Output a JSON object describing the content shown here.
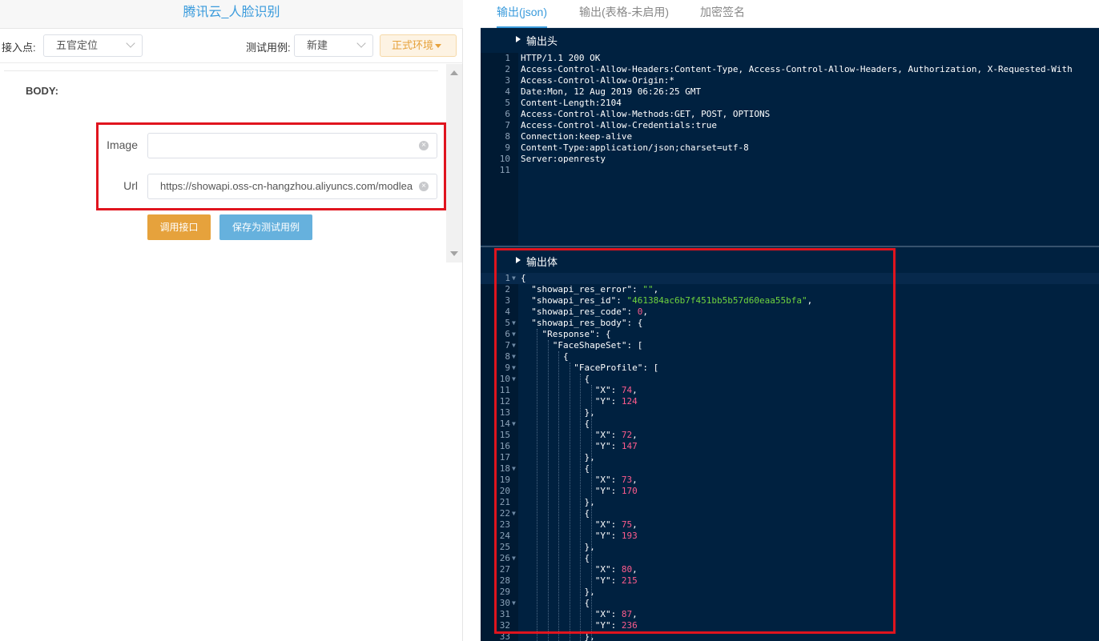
{
  "left": {
    "title": "腾讯云_人脸识别",
    "toolbar": {
      "endpoint_label": "接入点:",
      "endpoint_value": "五官定位",
      "testcase_label": "测试用例:",
      "testcase_value": "新建",
      "env_button": "正式环境"
    },
    "body_label": "BODY:",
    "fields": [
      {
        "label": "Image",
        "value": ""
      },
      {
        "label": "Url",
        "value": "https://showapi.oss-cn-hangzhou.aliyuncs.com/modlea"
      }
    ],
    "buttons": {
      "call": "调用接口",
      "save": "保存为测试用例"
    }
  },
  "right": {
    "tabs": [
      "输出(json)",
      "输出(表格-未启用)",
      "加密签名"
    ],
    "active_tab": 0,
    "header_section": "输出头",
    "body_section": "输出体",
    "header_lines": [
      "HTTP/1.1 200 OK",
      "Access-Control-Allow-Headers:Content-Type, Access-Control-Allow-Headers, Authorization, X-Requested-With",
      "Access-Control-Allow-Origin:*",
      "Date:Mon, 12 Aug 2019 06:26:25 GMT",
      "Content-Length:2104",
      "Access-Control-Allow-Methods:GET, POST, OPTIONS",
      "Access-Control-Allow-Credentials:true",
      "Connection:keep-alive",
      "Content-Type:application/json;charset=utf-8",
      "Server:openresty",
      ""
    ],
    "body_lines": [
      {
        "t": "{",
        "fold": true
      },
      {
        "t": "  \"showapi_res_error\": \"\","
      },
      {
        "t": "  \"showapi_res_id\": \"461384ac6b7f451bb5b57d60eaa55bfa\","
      },
      {
        "t": "  \"showapi_res_code\": 0,"
      },
      {
        "t": "  \"showapi_res_body\": {",
        "fold": true
      },
      {
        "t": "    \"Response\": {",
        "fold": true
      },
      {
        "t": "      \"FaceShapeSet\": [",
        "fold": true
      },
      {
        "t": "        {",
        "fold": true
      },
      {
        "t": "          \"FaceProfile\": [",
        "fold": true
      },
      {
        "t": "            {",
        "fold": true
      },
      {
        "t": "              \"X\": 74,"
      },
      {
        "t": "              \"Y\": 124"
      },
      {
        "t": "            },"
      },
      {
        "t": "            {",
        "fold": true
      },
      {
        "t": "              \"X\": 72,"
      },
      {
        "t": "              \"Y\": 147"
      },
      {
        "t": "            },"
      },
      {
        "t": "            {",
        "fold": true
      },
      {
        "t": "              \"X\": 73,"
      },
      {
        "t": "              \"Y\": 170"
      },
      {
        "t": "            },"
      },
      {
        "t": "            {",
        "fold": true
      },
      {
        "t": "              \"X\": 75,"
      },
      {
        "t": "              \"Y\": 193"
      },
      {
        "t": "            },"
      },
      {
        "t": "            {",
        "fold": true
      },
      {
        "t": "              \"X\": 80,"
      },
      {
        "t": "              \"Y\": 215"
      },
      {
        "t": "            },"
      },
      {
        "t": "            {",
        "fold": true
      },
      {
        "t": "              \"X\": 87,"
      },
      {
        "t": "              \"Y\": 236"
      },
      {
        "t": "            },"
      }
    ]
  }
}
